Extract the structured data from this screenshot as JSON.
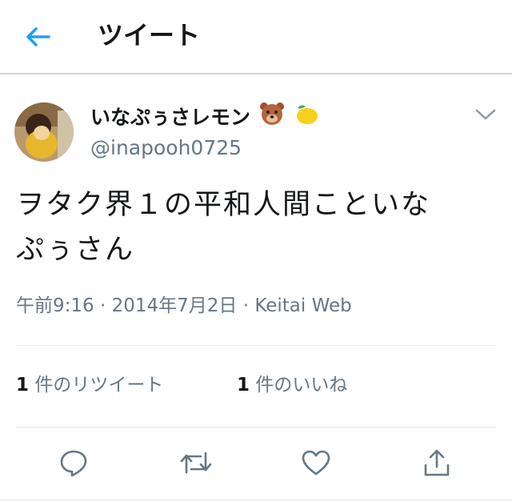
{
  "header": {
    "title": "ツイート",
    "back_icon": "arrow-left-icon"
  },
  "colors": {
    "accent": "#1da1f2",
    "secondary_text": "#657786",
    "action_icon": "#657786",
    "divider": "#e1e8ed"
  },
  "tweet": {
    "display_name": "いなぷぅさレモン",
    "name_emojis": [
      "bear-face-icon",
      "lemon-icon"
    ],
    "handle": "@inapooh0725",
    "text_line1": "ヲタク界１の平和人間こといな",
    "text_line2": "ぷぅさん",
    "meta": "午前9:16 · 2014年7月2日 · Keitai Web"
  },
  "stats": {
    "retweets": {
      "count": "1",
      "label": " 件のリツイート"
    },
    "likes": {
      "count": "1",
      "label": " 件のいいね"
    }
  },
  "actions": [
    "reply-icon",
    "retweet-icon",
    "like-icon",
    "share-icon"
  ]
}
